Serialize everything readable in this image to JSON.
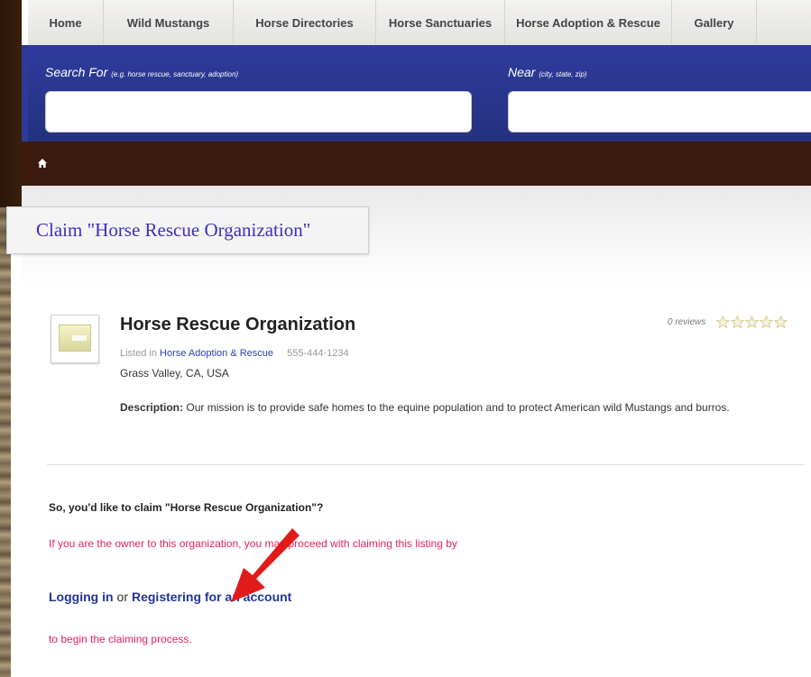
{
  "nav": {
    "items": [
      "Home",
      "Wild Mustangs",
      "Horse Directories",
      "Horse Sanctuaries",
      "Horse Adoption & Rescue",
      "Gallery"
    ]
  },
  "search": {
    "search_label": "Search For",
    "search_hint": "(e.g. horse rescue, sanctuary, adoption)",
    "near_label": "Near",
    "near_hint": "(city, state, zip)"
  },
  "claim": {
    "title": "Claim \"Horse Rescue Organization\""
  },
  "listing": {
    "name": "Horse Rescue Organization",
    "listed_in_label": "Listed in",
    "category": "Horse Adoption & Rescue",
    "phone": "555-444-1234",
    "location": "Grass Valley, CA, USA",
    "description_label": "Description:",
    "description": "Our mission is to provide safe homes to the equine population and to protect American wild Mustangs and burros.",
    "reviews": "0 reviews",
    "rating_stars_filled": 0,
    "rating_stars_total": 5
  },
  "claim_section": {
    "question": "So, you'd like to claim \"Horse Rescue Organization\"?",
    "owner_note": "If you are the owner to this organization, you may proceed with claiming this listing by",
    "login_link": "Logging in",
    "or_text": "or",
    "register_link": "Registering for an account",
    "begin_note": "to begin the claiming process."
  },
  "colors": {
    "nav_bg": "#ecebea",
    "search_band": "#2a3690",
    "crumb_bar": "#3a1b0e",
    "claim_title": "#3d2fc0",
    "link": "#2b3fae",
    "note_red": "#e0245a",
    "arrow_red": "#e11a1a"
  }
}
